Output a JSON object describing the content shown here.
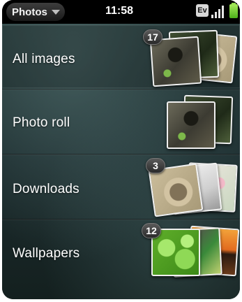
{
  "status_bar": {
    "app_menu_label": "Photos",
    "time": "11:58",
    "network_label": "Ev",
    "colors": {
      "battery": "#6ccf2c"
    }
  },
  "albums": [
    {
      "title": "All images",
      "count": "17"
    },
    {
      "title": "Photo roll",
      "count": ""
    },
    {
      "title": "Downloads",
      "count": "3"
    },
    {
      "title": "Wallpapers",
      "count": "12"
    }
  ],
  "icons": [
    "chevron-down-icon",
    "signal-bars-icon",
    "battery-icon"
  ]
}
